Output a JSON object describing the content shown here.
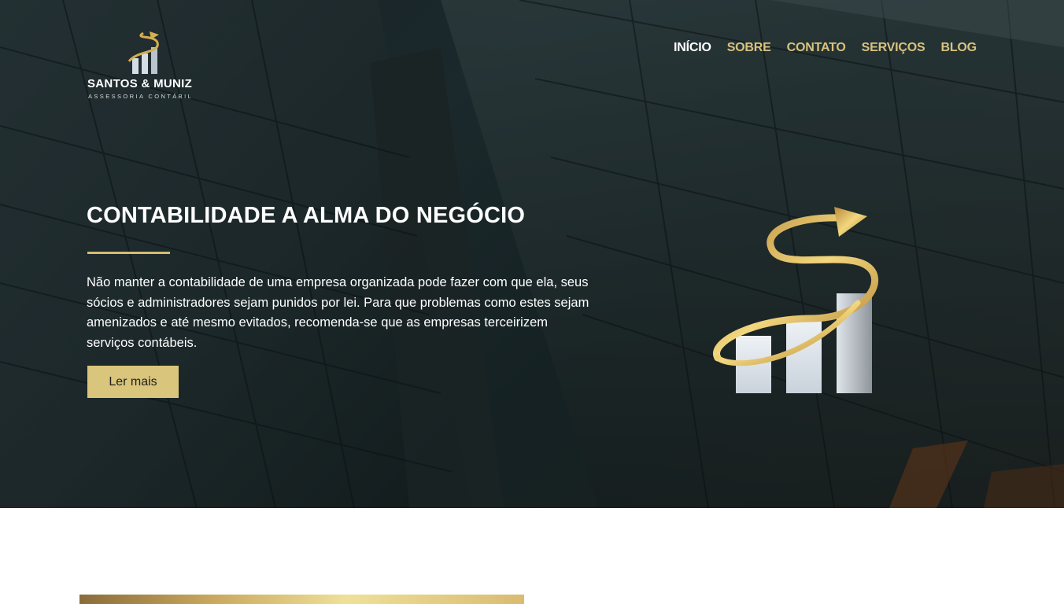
{
  "brand": {
    "name": "SANTOS & MUNIZ",
    "tagline": "ASSESSORIA CONTÁBIL",
    "logo_icon": "gold-arrow-bar-chart-icon"
  },
  "nav": {
    "items": [
      {
        "label": "INÍCIO",
        "active": true
      },
      {
        "label": "SOBRE",
        "active": false
      },
      {
        "label": "CONTATO",
        "active": false
      },
      {
        "label": "SERVIÇOS",
        "active": false
      },
      {
        "label": "BLOG",
        "active": false
      }
    ]
  },
  "hero": {
    "title": "CONTABILIDADE A ALMA DO NEGÓCIO",
    "text": "Não manter a contabilidade de uma empresa organizada pode fazer com que ela, seus sócios e administradores sejam punidos por lei. Para que problemas como estes sejam amenizados e até mesmo evitados, recomenda-se que as empresas terceirizem serviços contábeis.",
    "button_label": "Ler mais",
    "graphic_icon": "gold-arrow-bar-chart-icon"
  },
  "colors": {
    "accent_gold": "#d9c57b",
    "nav_gold": "#d8c27f",
    "hero_dark": "#1f2a2c",
    "white": "#ffffff"
  }
}
